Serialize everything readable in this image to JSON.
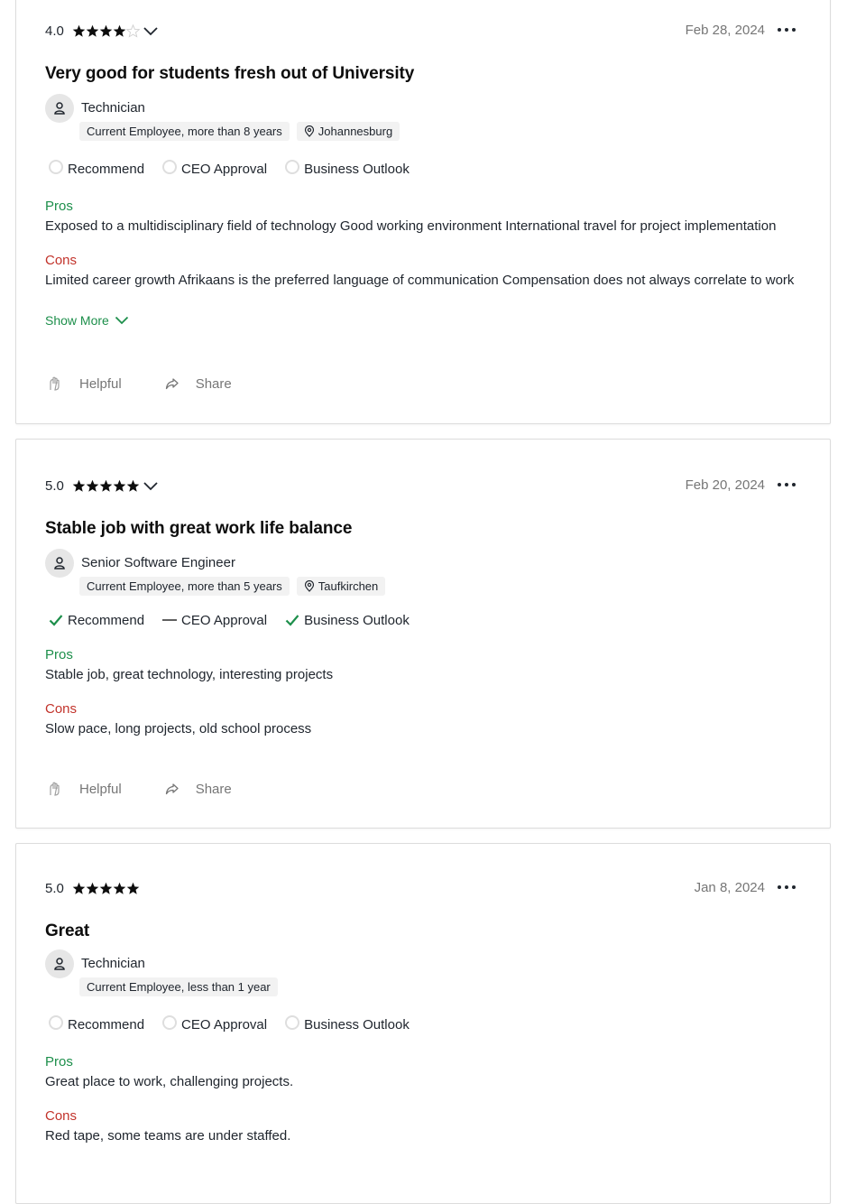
{
  "reviews": [
    {
      "rating": "4.0",
      "stars_filled": 4,
      "has_chevron": true,
      "date": "Feb 28, 2024",
      "title": "Very good for students fresh out of University",
      "job_title": "Technician",
      "employment": "Current Employee, more than 8 years",
      "location": "Johannesburg",
      "recommend": {
        "label": "Recommend",
        "state": "none"
      },
      "ceo": {
        "label": "CEO Approval",
        "state": "none"
      },
      "outlook": {
        "label": "Business Outlook",
        "state": "none"
      },
      "pros_label": "Pros",
      "pros": "Exposed to a multidisciplinary field of technology Good working environment International travel for project implementation",
      "cons_label": "Cons",
      "cons": "Limited career growth Afrikaans is the preferred language of communication Compensation does not always correlate to work",
      "show_more": "Show More",
      "helpful": "Helpful",
      "share": "Share"
    },
    {
      "rating": "5.0",
      "stars_filled": 5,
      "has_chevron": true,
      "date": "Feb 20, 2024",
      "title": "Stable job with great work life balance",
      "job_title": "Senior Software Engineer",
      "employment": "Current Employee, more than 5 years",
      "location": "Taufkirchen",
      "recommend": {
        "label": "Recommend",
        "state": "positive"
      },
      "ceo": {
        "label": "CEO Approval",
        "state": "neutral"
      },
      "outlook": {
        "label": "Business Outlook",
        "state": "positive"
      },
      "pros_label": "Pros",
      "pros": "Stable job, great technology, interesting projects",
      "cons_label": "Cons",
      "cons": "Slow pace, long projects, old school process",
      "helpful": "Helpful",
      "share": "Share"
    },
    {
      "rating": "5.0",
      "stars_filled": 5,
      "has_chevron": false,
      "date": "Jan 8, 2024",
      "title": "Great",
      "job_title": "Technician",
      "employment": "Current Employee, less than 1 year",
      "recommend": {
        "label": "Recommend",
        "state": "none"
      },
      "ceo": {
        "label": "CEO Approval",
        "state": "none"
      },
      "outlook": {
        "label": "Business Outlook",
        "state": "none"
      },
      "pros_label": "Pros",
      "pros": "Great place to work, challenging projects.",
      "cons_label": "Cons",
      "cons": "Red tape, some teams are under staffed."
    }
  ],
  "colors": {
    "pros": "#1d8f4b",
    "cons": "#c2332b",
    "check": "#1d8f4b",
    "muted": "#767676"
  },
  "icons": {
    "star": "star-icon",
    "more": "more-horizontal-icon",
    "avatar": "person-icon",
    "location": "location-pin-icon",
    "helpful": "helpful-hands-icon",
    "share": "share-arrow-icon",
    "chevron": "chevron-down-icon",
    "check": "check-icon"
  }
}
